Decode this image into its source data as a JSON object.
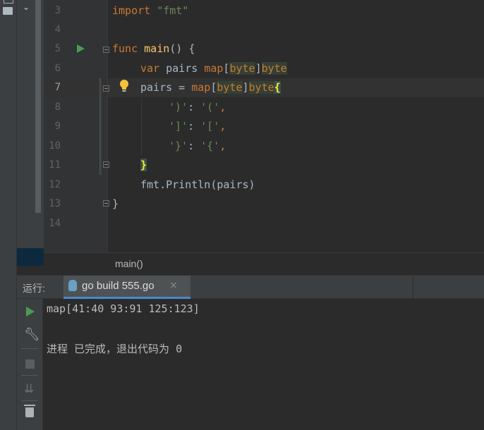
{
  "editor": {
    "line_numbers": [
      "3",
      "4",
      "5",
      "6",
      "7",
      "8",
      "9",
      "10",
      "11",
      "12",
      "13",
      "14"
    ],
    "lines": {
      "l3": {
        "kw": "import",
        "str": "\"fmt\""
      },
      "l5": {
        "kw": "func",
        "fn": "main",
        "rest": "() {"
      },
      "l6": {
        "kw": "var",
        "name": " pairs ",
        "map": "map",
        "lb": "[",
        "key": "byte",
        "rb": "]",
        "val": "byte"
      },
      "l7": {
        "name": "pairs = ",
        "map": "map",
        "lb": "[",
        "key": "byte",
        "rb": "]",
        "val": "byte",
        "brace": "{"
      },
      "l8": {
        "k": "')'",
        "sep": ": ",
        "v": "'('",
        "comma": ","
      },
      "l9": {
        "k": "']'",
        "sep": ": ",
        "v": "'['",
        "comma": ","
      },
      "l10": {
        "k": "'}'",
        "sep": ": ",
        "v": "'{'",
        "comma": ","
      },
      "l11": {
        "brace": "}"
      },
      "l12": {
        "text": "fmt.Println(pairs)"
      },
      "l13": {
        "text": "}"
      }
    }
  },
  "breadcrumb": {
    "label": "main()"
  },
  "run_panel": {
    "label": "运行:",
    "tab_label": "go build 555.go",
    "tab_close": "×",
    "output": [
      "map[41:40 93:91 125:123]",
      "进程 已完成，退出代码为 0"
    ]
  },
  "colors": {
    "accent": "#4a88c7",
    "run_green": "#499c54",
    "keyword": "#cc7832",
    "string": "#6a8759",
    "function": "#ffc66d"
  }
}
